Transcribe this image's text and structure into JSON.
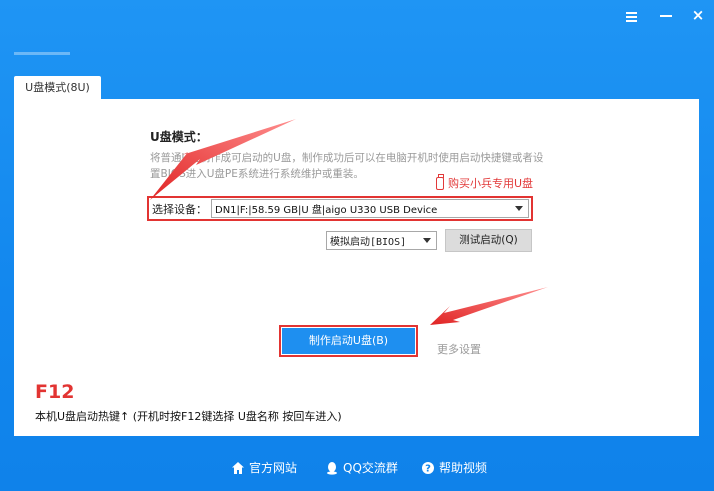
{
  "window": {
    "menu_icon": "menu-icon",
    "minimize_icon": "minimize-icon",
    "close_icon": "close-icon",
    "close_glyph": "×"
  },
  "tab": {
    "label": "U盘模式(8U)"
  },
  "panel": {
    "mode_title": "U盘模式：",
    "description": "将普通U盘制作成可启动的U盘，制作成功后可以在电脑开机时使用启动快捷键或者设置BIOS进入U盘PE系统进行系统维护或重装。",
    "buy_link": "购买小兵专用U盘",
    "device_label": "选择设备：",
    "device_value": "DN1|F:|58.59 GB|U 盘|aigo U330 USB Device",
    "boot_mode_value": "模拟启动[BIOS]",
    "test_button": "测试启动(Q)",
    "make_button": "制作启动U盘(B)",
    "more_settings": "更多设置",
    "hotkey_key": "F12",
    "hotkey_text": "本机U盘启动热键↑ (开机时按F12键选择 U盘名称 按回车进入)"
  },
  "footer": {
    "official_site": "官方网站",
    "qq_group": "QQ交流群",
    "help_video": "帮助视频"
  },
  "colors": {
    "primary_blue": "#1287ee",
    "highlight_red": "#e23432",
    "muted_text": "#9a9a9a"
  }
}
